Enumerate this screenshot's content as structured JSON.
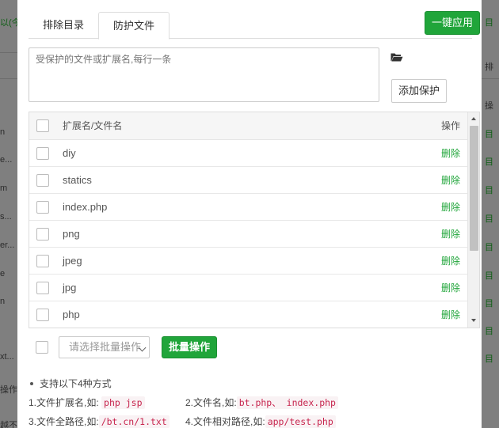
{
  "background_left": {
    "snippets": [
      "以(今",
      "n",
      "e...",
      "m",
      "s...",
      "er...",
      "e",
      "n",
      "xt...",
      "操作",
      "越不"
    ]
  },
  "background_right": {
    "snippets": [
      "目",
      "排",
      "操",
      "目",
      "目",
      "目",
      "目",
      "目",
      "目",
      "目",
      "目",
      "目"
    ]
  },
  "tabs": {
    "exclude": "排除目录",
    "protect": "防护文件"
  },
  "apply_button": "一键应用",
  "protect_input": {
    "placeholder": "受保护的文件或扩展名,每行一条",
    "value": ""
  },
  "add_button": "添加保护",
  "table": {
    "col_name": "扩展名/文件名",
    "col_op": "操作",
    "rows": [
      {
        "name": "diy",
        "op": "删除"
      },
      {
        "name": "statics",
        "op": "删除"
      },
      {
        "name": "index.php",
        "op": "删除"
      },
      {
        "name": "png",
        "op": "删除"
      },
      {
        "name": "jpeg",
        "op": "删除"
      },
      {
        "name": "jpg",
        "op": "删除"
      },
      {
        "name": "php",
        "op": "删除"
      }
    ]
  },
  "batch": {
    "select_placeholder": "请选择批量操作",
    "button": "批量操作"
  },
  "tips": {
    "heading": "支持以下4种方式",
    "t1_label": "1.文件扩展名,如:",
    "t1_code": "php jsp",
    "t2_label": "2.文件名,如:",
    "t2_code": "bt.php、 index.php",
    "t3_label": "3.文件全路径,如:",
    "t3_code": "/bt.cn/1.txt",
    "t4_label": "4.文件相对路径,如:",
    "t4_code": "app/test.php"
  },
  "colors": {
    "accent": "#20a53a",
    "code_text": "#c7254e"
  }
}
